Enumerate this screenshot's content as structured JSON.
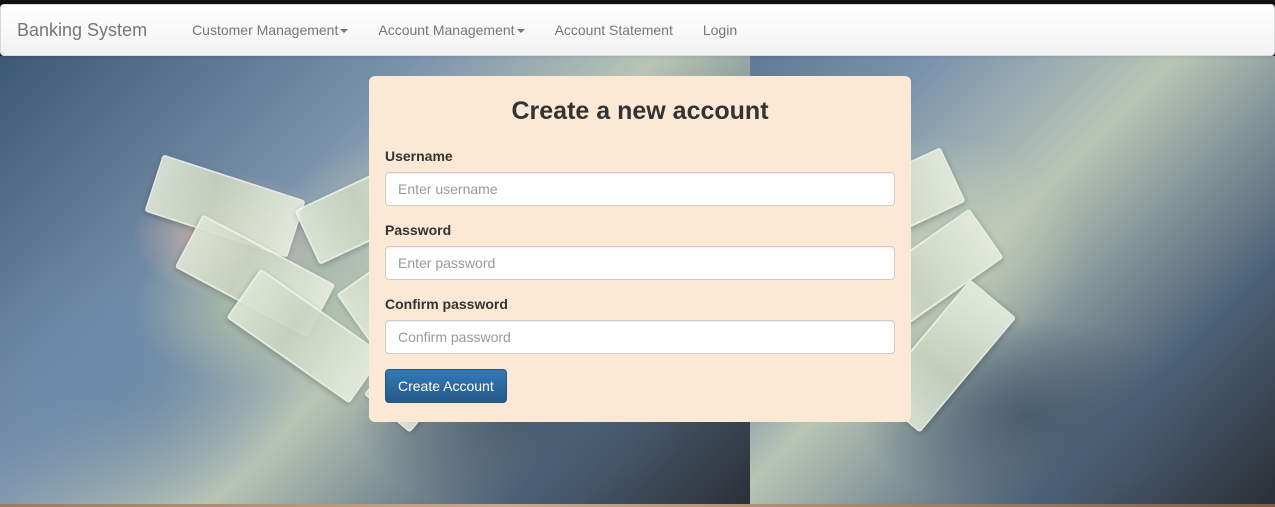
{
  "navbar": {
    "brand": "Banking System",
    "items": [
      {
        "label": "Customer Management",
        "dropdown": true
      },
      {
        "label": "Account Management",
        "dropdown": true
      },
      {
        "label": "Account Statement",
        "dropdown": false
      },
      {
        "label": "Login",
        "dropdown": false
      }
    ]
  },
  "form": {
    "title": "Create a new account",
    "username_label": "Username",
    "username_placeholder": "Enter username",
    "username_value": "",
    "password_label": "Password",
    "password_placeholder": "Enter password",
    "password_value": "",
    "confirm_label": "Confirm password",
    "confirm_placeholder": "Confirm password",
    "confirm_value": "",
    "submit_label": "Create Account"
  },
  "colors": {
    "card_background": "#fbe9d5",
    "button_primary": "#337ab7",
    "navbar_text": "#777777"
  },
  "background": {
    "image": "hands-holding-dollar-bills-photo"
  }
}
